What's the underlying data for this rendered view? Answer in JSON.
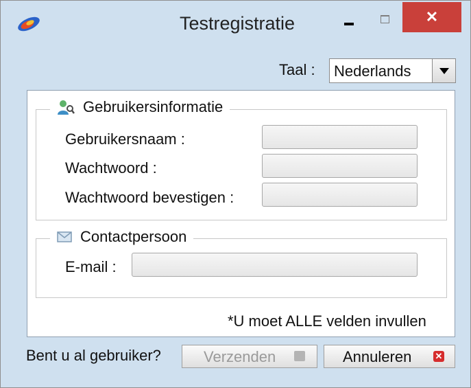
{
  "window": {
    "title": "Testregistratie",
    "close_glyph": "✕",
    "icons": [
      "app-logo-icon",
      "minimize-icon",
      "maximize-icon",
      "close-icon"
    ]
  },
  "language": {
    "label": "Taal :",
    "selected": "Nederlands"
  },
  "user_info": {
    "legend": "Gebruikersinformatie",
    "icon": "users-search-icon",
    "username_label": "Gebruikersnaam :",
    "password_label": "Wachtwoord :",
    "confirm_label": "Wachtwoord bevestigen :",
    "username_value": "",
    "password_value": "",
    "confirm_value": ""
  },
  "contact": {
    "legend": "Contactpersoon",
    "icon": "envelope-icon",
    "email_label": "E-mail :",
    "email_value": ""
  },
  "required_note": "*U moet ALLE velden invullen",
  "footer": {
    "existing_user": "Bent u al gebruiker?",
    "send_label": "Verzenden",
    "cancel_label": "Annuleren",
    "cancel_glyph": "✕"
  }
}
